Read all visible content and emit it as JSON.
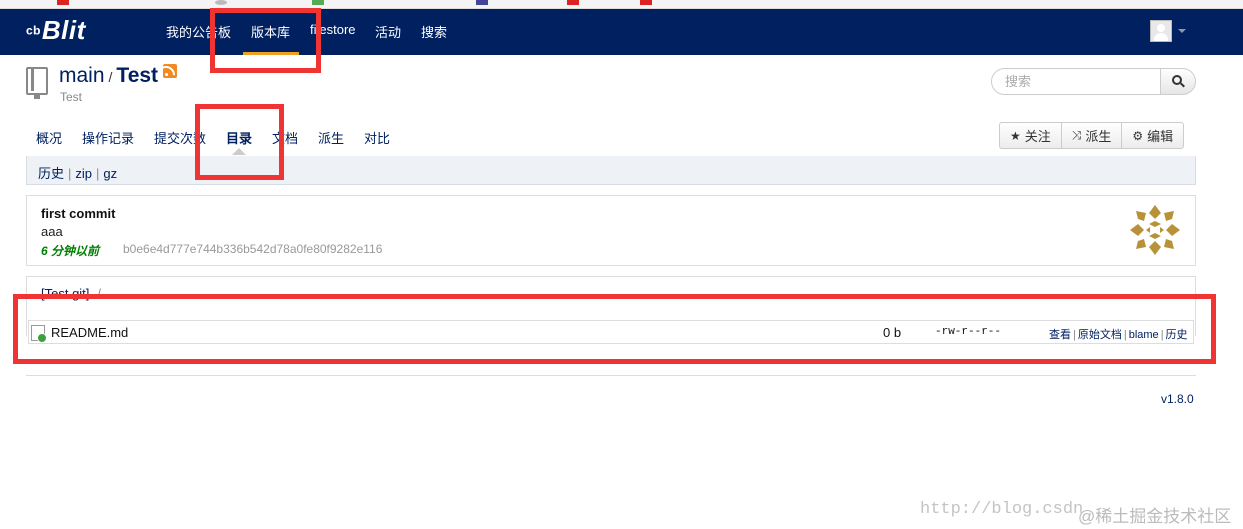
{
  "colors": {
    "navbar": "#002060",
    "accent": "#f0a020",
    "annotation": "#f03434",
    "link": "#002060",
    "commit_age": "#008000"
  },
  "navbar": {
    "brand": "Blit",
    "brand_glyph": "ᶜᵇ",
    "items": [
      {
        "label": "我的公告板"
      },
      {
        "label": "版本库"
      },
      {
        "label": "filestore"
      },
      {
        "label": "活动"
      },
      {
        "label": "搜索"
      }
    ],
    "active_index": 1,
    "user_icon": "user-avatar-icon"
  },
  "repo": {
    "project": "main",
    "separator": "/",
    "name": "Test",
    "description": "Test",
    "icon": "repository-icon",
    "feed_icon": "rss-icon"
  },
  "search": {
    "placeholder": "搜索",
    "icon": "search-icon"
  },
  "tabs": [
    {
      "label": "概况"
    },
    {
      "label": "操作记录"
    },
    {
      "label": "提交次数"
    },
    {
      "label": "目录"
    },
    {
      "label": "文档"
    },
    {
      "label": "派生"
    },
    {
      "label": "对比"
    }
  ],
  "active_tab": 3,
  "actions": [
    {
      "label": "关注",
      "icon": "★"
    },
    {
      "label": "派生",
      "icon": "⤨"
    },
    {
      "label": "编辑",
      "icon": "⚙"
    }
  ],
  "subnav": {
    "history": "历史",
    "zip": "zip",
    "gz": "gz"
  },
  "commit": {
    "title": "first commit",
    "message": "aaa",
    "age": "6 分钟以前",
    "hash": "b0e6e4d777e744b336b542d78a0fe80f9282e116"
  },
  "breadcrumb": {
    "root": "[Test.git]",
    "sep": "/"
  },
  "files": [
    {
      "name": "README.md",
      "size": "0 b",
      "mode": "-rw-r--r--",
      "links": {
        "view": "查看",
        "raw": "原始文档",
        "blame": "blame",
        "history": "历史"
      }
    }
  ],
  "footer": {
    "version": "v1.8.0"
  },
  "watermark": {
    "url": "http://blog.csdn",
    "site": "@稀土掘金技术社区"
  }
}
